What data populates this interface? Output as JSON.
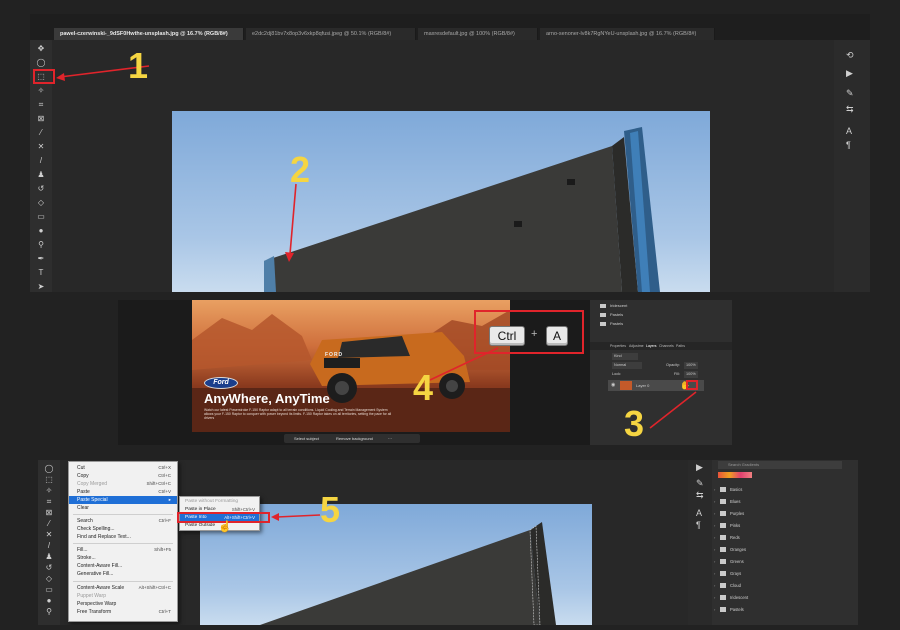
{
  "tabs": [
    {
      "label": "pawel-czerwinski-_9dSF0Hwthe-unsplash.jpg @ 16.7% (RGB/8#)",
      "active": true
    },
    {
      "label": "e2dc2dj81bv7x8op3v6xkp8qfusi.jpeg @ 50.1% (RGB/8#)",
      "active": false
    },
    {
      "label": "maxresdefault.jpg @ 100% (RGB/8#)",
      "active": false
    },
    {
      "label": "arno-senoner-lv8k7RgNYeU-unsplash.jpg @ 16.7% (RGB/8#)",
      "active": false
    }
  ],
  "steps": [
    "1",
    "2",
    "3",
    "4",
    "5"
  ],
  "ad": {
    "title": "AnyWhere, AnyTime",
    "body": "Watch our latest Powerstroke F-150 Raptor adapt to all terrain conditions. Liquid Cooling and Terrain Management System allows your F-150 Raptor to conquer with power beyond its limits. F-150 Raptor takes on all territories, setting the pace for all drivers",
    "brand": "Ford",
    "truck_badge": "FORD"
  },
  "contextual_bar": {
    "select_subject": "Select subject",
    "remove_background": "Remove background"
  },
  "keys": {
    "ctrl": "Ctrl",
    "plus": "+",
    "a": "A"
  },
  "layers_panel": {
    "folders": [
      "Iridescent",
      "Pastels",
      "Pastels"
    ],
    "tabs": [
      "Properties",
      "Adjustme",
      "Layers",
      "Channels",
      "Paths"
    ],
    "kind": "Kind",
    "mode": "Normal",
    "opacity_label": "Opacity:",
    "opacity": "100%",
    "lock_label": "Lock:",
    "fill_label": "Fill:",
    "fill": "100%",
    "layer_name": "Layer 0"
  },
  "edit_menu": {
    "items": [
      {
        "label": "Cut",
        "shortcut": "Ctrl+X",
        "disabled": false
      },
      {
        "label": "Copy",
        "shortcut": "Ctrl+C",
        "disabled": false
      },
      {
        "label": "Copy Merged",
        "shortcut": "Shift+Ctrl+C",
        "disabled": true
      },
      {
        "label": "Paste",
        "shortcut": "Ctrl+V",
        "disabled": false
      },
      {
        "label": "Paste Special",
        "shortcut": "",
        "highlighted": true
      },
      {
        "label": "Clear",
        "shortcut": "",
        "disabled": false
      },
      {
        "label": "Search",
        "shortcut": "Ctrl+F",
        "disabled": false
      },
      {
        "label": "Check Spelling...",
        "shortcut": "",
        "disabled": false
      },
      {
        "label": "Find and Replace Text...",
        "shortcut": "",
        "disabled": false
      },
      {
        "label": "Fill...",
        "shortcut": "Shift+F5",
        "disabled": false
      },
      {
        "label": "Stroke...",
        "shortcut": "",
        "disabled": false
      },
      {
        "label": "Content-Aware Fill...",
        "shortcut": "",
        "disabled": false
      },
      {
        "label": "Generative Fill...",
        "shortcut": "",
        "disabled": false
      },
      {
        "label": "Content-Aware Scale",
        "shortcut": "Alt+Shift+Ctrl+C",
        "disabled": false
      },
      {
        "label": "Puppet Warp",
        "shortcut": "",
        "disabled": true
      },
      {
        "label": "Perspective Warp",
        "shortcut": "",
        "disabled": false
      },
      {
        "label": "Free Transform",
        "shortcut": "Ctrl+T",
        "disabled": false
      }
    ]
  },
  "paste_special_submenu": [
    {
      "label": "Paste without Formatting",
      "shortcut": "",
      "disabled": true
    },
    {
      "label": "Paste in Place",
      "shortcut": "Shift+Ctrl+V",
      "disabled": false
    },
    {
      "label": "Paste Into",
      "shortcut": "Alt+Shift+Ctrl+V",
      "highlighted": true
    },
    {
      "label": "Paste Outside",
      "shortcut": "",
      "disabled": false
    }
  ],
  "swatches": {
    "search_placeholder": "Search Gradients",
    "groups": [
      "Basics",
      "Blues",
      "Purples",
      "Pinks",
      "Reds",
      "Oranges",
      "Greens",
      "Grays",
      "Cloud",
      "Iridescent",
      "Pastels"
    ]
  },
  "colors": {
    "highlight": "#e0242b",
    "step_number": "#f5d542",
    "menu_highlight": "#1f6fd6",
    "sky": "#9dbde3"
  }
}
